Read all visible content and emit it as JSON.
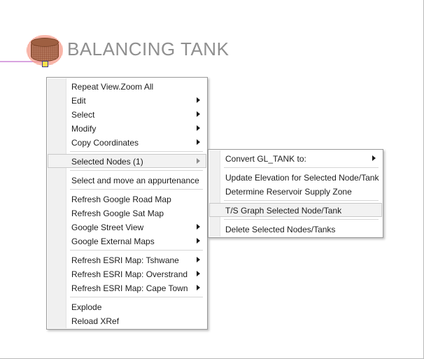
{
  "drawing": {
    "title": "BALANCING TANK",
    "tank_icon": "tank-cylinder-icon",
    "grip_icon": "grip-square-icon",
    "pipe_icon": "pipe-line"
  },
  "context_menu": {
    "items": [
      {
        "label": "Repeat View.Zoom All",
        "arrow": false,
        "highlighted": false,
        "separator_after": false
      },
      {
        "label": "Edit",
        "arrow": true,
        "highlighted": false,
        "separator_after": false
      },
      {
        "label": "Select",
        "arrow": true,
        "highlighted": false,
        "separator_after": false
      },
      {
        "label": "Modify",
        "arrow": true,
        "highlighted": false,
        "separator_after": false
      },
      {
        "label": "Copy Coordinates",
        "arrow": true,
        "highlighted": false,
        "separator_after": true
      },
      {
        "label": "Selected Nodes (1)",
        "arrow": true,
        "highlighted": true,
        "separator_after": true
      },
      {
        "label": "Select and move an appurtenance",
        "arrow": false,
        "highlighted": false,
        "separator_after": true
      },
      {
        "label": "Refresh Google Road Map",
        "arrow": false,
        "highlighted": false,
        "separator_after": false
      },
      {
        "label": "Refresh Google Sat Map",
        "arrow": false,
        "highlighted": false,
        "separator_after": false
      },
      {
        "label": "Google Street View",
        "arrow": true,
        "highlighted": false,
        "separator_after": false
      },
      {
        "label": "Google External Maps",
        "arrow": true,
        "highlighted": false,
        "separator_after": true
      },
      {
        "label": "Refresh ESRI Map: Tshwane",
        "arrow": true,
        "highlighted": false,
        "separator_after": false
      },
      {
        "label": "Refresh ESRI Map: Overstrand",
        "arrow": true,
        "highlighted": false,
        "separator_after": false
      },
      {
        "label": "Refresh ESRI Map: Cape Town",
        "arrow": true,
        "highlighted": false,
        "separator_after": true
      },
      {
        "label": "Explode",
        "arrow": false,
        "highlighted": false,
        "separator_after": false
      },
      {
        "label": "Reload XRef",
        "arrow": false,
        "highlighted": false,
        "separator_after": false
      }
    ]
  },
  "sub_menu": {
    "items": [
      {
        "label": "Convert GL_TANK to:",
        "arrow": true,
        "highlighted": false,
        "separator_after": true
      },
      {
        "label": "Update Elevation for Selected Node/Tank",
        "arrow": false,
        "highlighted": false,
        "separator_after": false
      },
      {
        "label": "Determine Reservoir Supply Zone",
        "arrow": false,
        "highlighted": false,
        "separator_after": true
      },
      {
        "label": "T/S Graph Selected Node/Tank",
        "arrow": false,
        "highlighted": true,
        "separator_after": true
      },
      {
        "label": "Delete Selected Nodes/Tanks",
        "arrow": false,
        "highlighted": false,
        "separator_after": false
      }
    ]
  },
  "colors": {
    "menu_background": "#ffffff",
    "menu_border": "#9a9a9a",
    "gutter": "#f0f0f0",
    "highlight_background": "#f2f2f2",
    "highlight_border": "#c9c9c9",
    "title_text": "#8f8f8f",
    "menu_text": "#1d1d1d",
    "tank_body": "#b2755a",
    "tank_outline": "#7c4429",
    "selection_halo": "#f0826e",
    "grip_fill": "#ffe14d",
    "pipe": "#d9a4e0"
  }
}
